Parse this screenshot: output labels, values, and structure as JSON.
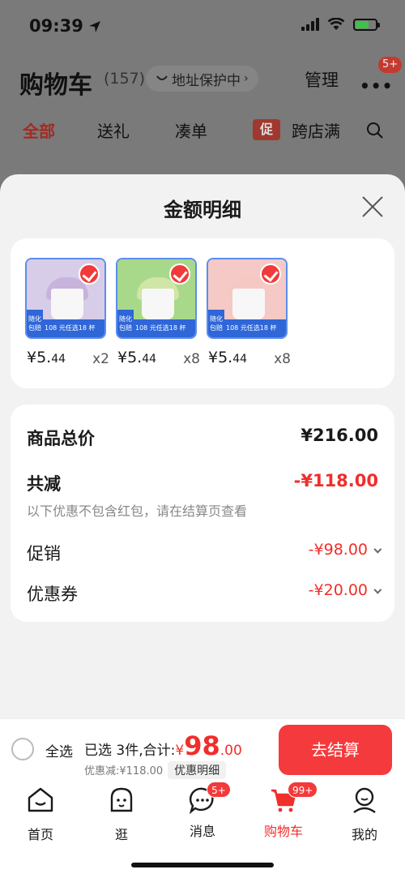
{
  "status_bar": {
    "time": "09:39"
  },
  "cart_header": {
    "title": "购物车",
    "count": "(157)",
    "address_protect": "地址保护中",
    "manage_label": "管理",
    "more_badge": "5+"
  },
  "tabs": [
    {
      "label": "全部"
    },
    {
      "label": "送礼"
    },
    {
      "label": "凑单"
    },
    {
      "label": "跨店满"
    }
  ],
  "promo_icon_text": "促",
  "sheet": {
    "title": "金额明细",
    "products": [
      {
        "price_main": "¥5.",
        "price_dec": "44",
        "qty": "x2",
        "band_text": "108 元任选18 杯",
        "tag_text": "随化 包赔",
        "scoop_color": "#c7b3dc",
        "bg_color": "#d8cde8"
      },
      {
        "price_main": "¥5.",
        "price_dec": "44",
        "qty": "x8",
        "band_text": "108 元任选18 杯",
        "tag_text": "随化 包赔",
        "scoop_color": "#cfe6a6",
        "bg_color": "#a8d98a"
      },
      {
        "price_main": "¥5.",
        "price_dec": "44",
        "qty": "x8",
        "band_text": "108 元任选18 杯",
        "tag_text": "随化 包赔",
        "scoop_color": "#f5c8c4",
        "bg_color": "#f4c9c6"
      }
    ],
    "summary": {
      "goods_total_label": "商品总价",
      "goods_total_value": "¥216.00",
      "reduction_label": "共减",
      "reduction_value": "-¥118.00",
      "reduction_note": "以下优惠不包含红包，请在结算页查看",
      "promo_label": "促销",
      "promo_value": "-¥98.00",
      "coupon_label": "优惠券",
      "coupon_value": "-¥20.00"
    }
  },
  "bottom_bar": {
    "select_all": "全选",
    "selected_text": "已选 3件,合计:",
    "total_yen": "¥",
    "total_int": "98",
    "total_dec": ".00",
    "discount_text": "优惠减:¥118.00",
    "detail_label": "优惠明细",
    "checkout_label": "去结算"
  },
  "tab_bar": [
    {
      "label": "首页"
    },
    {
      "label": "逛"
    },
    {
      "label": "消息",
      "badge": "5+"
    },
    {
      "label": "购物车",
      "badge": "99+"
    },
    {
      "label": "我的"
    }
  ],
  "colors": {
    "accent": "#f02e2a",
    "checkout_bg": "#f43a3c",
    "thumb_border": "#5b8def"
  }
}
